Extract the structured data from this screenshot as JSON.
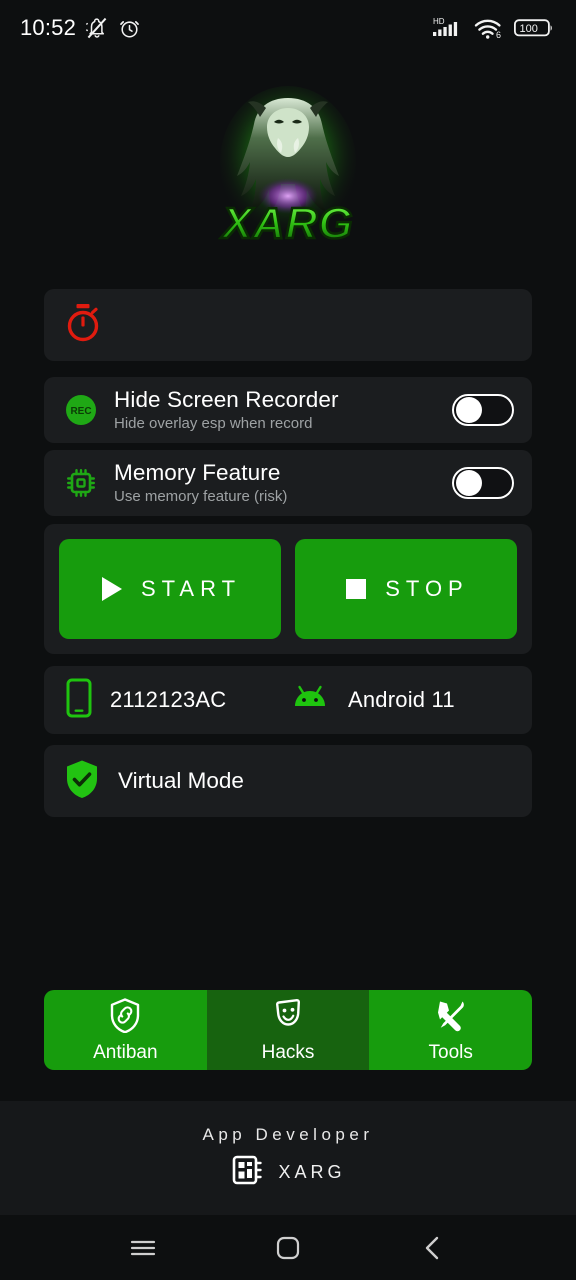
{
  "statusbar": {
    "time": "10:52",
    "left_icons": [
      "bell-mute-icon",
      "alarm-clock-icon"
    ],
    "network_label": "HD",
    "wifi_label": "6",
    "battery_level": "100"
  },
  "logo": {
    "name": "xarg-logo",
    "wordmark": "XARG",
    "glow_color": "#33dd22"
  },
  "timer_card": {
    "icon": "stopwatch-icon",
    "icon_color": "#e01b0f"
  },
  "toggles": [
    {
      "icon": "rec-icon",
      "title": "Hide Screen Recorder",
      "subtitle": "Hide overlay esp when record",
      "state": "off"
    },
    {
      "icon": "memory-chip-icon",
      "title": "Memory Feature",
      "subtitle": "Use memory feature (risk)",
      "state": "off"
    }
  ],
  "actions": {
    "start_label": "START",
    "stop_label": "STOP",
    "start_icon": "play-icon",
    "stop_icon": "stop-square-icon",
    "accent": "#179c0d"
  },
  "device": {
    "model_icon": "smartphone-icon",
    "model": "2112123AC",
    "os_icon": "android-robot-icon",
    "os": "Android 11"
  },
  "virtual_mode": {
    "icon": "shield-check-icon",
    "label": "Virtual Mode"
  },
  "tabs": [
    {
      "label": "Antiban",
      "icon": "shield-link-icon",
      "selected": true
    },
    {
      "label": "Hacks",
      "icon": "theater-mask-icon",
      "selected": false
    },
    {
      "label": "Tools",
      "icon": "wrench-screwdriver-icon",
      "selected": true
    }
  ],
  "footer": {
    "title": "App Developer",
    "developer_icon": "chip-icon",
    "developer": "XARG"
  },
  "navbar": {
    "recents": "menu-icon",
    "home": "home-square-icon",
    "back": "back-chevron-icon"
  }
}
